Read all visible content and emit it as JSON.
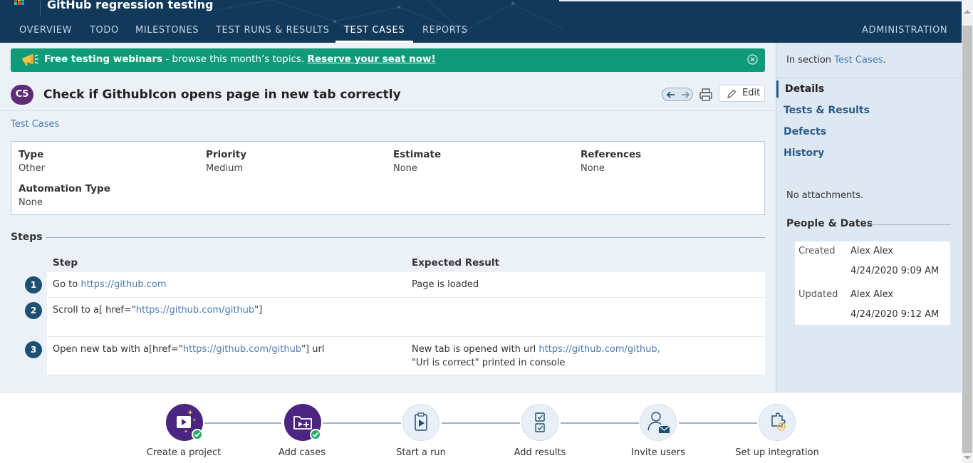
{
  "header": {
    "app_title": "GitHub regression testing",
    "tabs": [
      {
        "label": "OVERVIEW"
      },
      {
        "label": "TODO"
      },
      {
        "label": "MILESTONES"
      },
      {
        "label": "TEST RUNS & RESULTS"
      },
      {
        "label": "TEST CASES",
        "active": true
      },
      {
        "label": "REPORTS"
      }
    ],
    "admin_label": "ADMINISTRATION"
  },
  "banner": {
    "icon": "megaphone-icon",
    "bold_text": "Free testing webinars",
    "text": " - browse this month’s topics. ",
    "link": "Reserve your seat now!"
  },
  "case": {
    "id": "C5",
    "title": "Check if GithubIcon opens page in new tab correctly",
    "edit_label": "Edit",
    "breadcrumb": "Test Cases",
    "fields": {
      "type": {
        "label": "Type",
        "value": "Other"
      },
      "priority": {
        "label": "Priority",
        "value": "Medium"
      },
      "estimate": {
        "label": "Estimate",
        "value": "None"
      },
      "references": {
        "label": "References",
        "value": "None"
      },
      "automation": {
        "label": "Automation Type",
        "value": "None"
      }
    }
  },
  "steps": {
    "title": "Steps",
    "col_step": "Step",
    "col_expected": "Expected Result",
    "rows": [
      {
        "num": "1",
        "pre": "Go to ",
        "link": "https://github.com",
        "post": "",
        "exp_pre": "Page is loaded",
        "exp_link": "",
        "exp_post": "",
        "exp_line2": ""
      },
      {
        "num": "2",
        "pre": "Scroll to a[ href=\"",
        "link": "https://github.com/github",
        "post": "\"]",
        "exp_pre": "",
        "exp_link": "",
        "exp_post": "",
        "exp_line2": ""
      },
      {
        "num": "3",
        "pre": "Open new tab with a[href=\"",
        "link": "https://github.com/github",
        "post": "\"] url",
        "exp_pre": "New tab is opened with url ",
        "exp_link": "https://github.com/github,",
        "exp_post": "",
        "exp_line2": "\"Url is correct\" printed in console"
      }
    ]
  },
  "sidebar": {
    "section_prefix": "In section ",
    "section_link": "Test Cases",
    "section_suffix": ".",
    "links": [
      {
        "label": "Details",
        "active": true
      },
      {
        "label": "Tests & Results"
      },
      {
        "label": "Defects"
      },
      {
        "label": "History"
      }
    ],
    "no_attachments": "No attachments.",
    "people_title": "People & Dates",
    "created_label": "Created",
    "created_by": "Alex Alex",
    "created_at": "4/24/2020 9:09 AM",
    "updated_label": "Updated",
    "updated_by": "Alex Alex",
    "updated_at": "4/24/2020 9:12 AM"
  },
  "onboarding": [
    {
      "label": "Create a project",
      "done": true,
      "icon": "create-project-icon"
    },
    {
      "label": "Add cases",
      "done": true,
      "icon": "add-cases-icon"
    },
    {
      "label": "Start a run",
      "done": false,
      "icon": "start-run-icon"
    },
    {
      "label": "Add results",
      "done": false,
      "icon": "add-results-icon"
    },
    {
      "label": "Invite users",
      "done": false,
      "icon": "invite-users-icon"
    },
    {
      "label": "Set up integration",
      "done": false,
      "icon": "integration-icon"
    }
  ],
  "colors": {
    "header_bg": "#12395a",
    "banner_bg": "#0f9b7a",
    "case_badge": "#5f2a76",
    "step_badge": "#1d4f73",
    "link": "#4a7bb0",
    "onboarding_done": "#4c2583",
    "check": "#26a96a"
  }
}
